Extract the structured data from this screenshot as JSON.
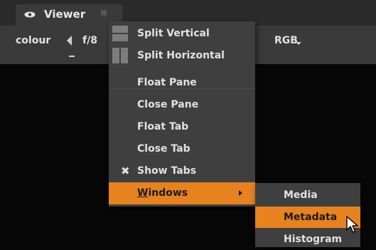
{
  "tab": {
    "title": "Viewer",
    "close_glyph": "✖"
  },
  "toolbar": {
    "colour_label": "colour",
    "fstop_label": "f/8",
    "channel_label": "RGB"
  },
  "menu": {
    "items": [
      {
        "label": "Split Vertical",
        "icon": "split-vertical-icon"
      },
      {
        "label": "Split Horizontal",
        "icon": "split-horizontal-icon"
      },
      {
        "label": "Float Pane"
      },
      {
        "label": "Close Pane"
      },
      {
        "label": "Float Tab"
      },
      {
        "label": "Close Tab"
      },
      {
        "label": "Show Tabs",
        "checked": true,
        "check_glyph": "✖"
      },
      {
        "label_first": "W",
        "label_rest": "indows",
        "highlighted": true,
        "has_submenu": true
      }
    ]
  },
  "submenu": {
    "items": [
      {
        "label": "Media"
      },
      {
        "label": "Metadata",
        "highlighted": true
      },
      {
        "label": "Histogram"
      }
    ]
  },
  "colors": {
    "accent": "#e8821e",
    "menu_bg": "#3f3f3f",
    "toolbar_bg": "#3a3a3a",
    "viewer_bg": "#070707"
  }
}
